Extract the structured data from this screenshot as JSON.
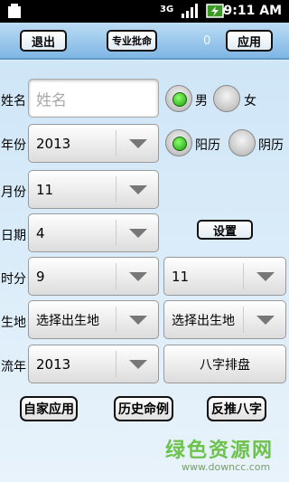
{
  "status": {
    "time": "9:11 AM",
    "network": "3G"
  },
  "toolbar": {
    "exit_label": "退出",
    "pro_label": "专业批命",
    "count": "0",
    "apply_label": "应用"
  },
  "form": {
    "name": {
      "label": "姓名",
      "placeholder": "姓名"
    },
    "gender": {
      "male": "男",
      "female": "女",
      "selected": "male"
    },
    "year": {
      "label": "年份",
      "value": "2013"
    },
    "calendar": {
      "solar": "阳历",
      "lunar": "阴历",
      "selected": "solar"
    },
    "month": {
      "label": "月份",
      "value": "11"
    },
    "day": {
      "label": "日期",
      "value": "4"
    },
    "settings_label": "设置",
    "time": {
      "label": "时分",
      "hour": "9",
      "minute": "11"
    },
    "birthplace": {
      "label": "生地",
      "province": "选择出生地",
      "city": "选择出生地"
    },
    "flow_year": {
      "label": "流年",
      "value": "2013"
    },
    "bazi_label": "八字排盘"
  },
  "bottom": {
    "own_apps": "自家应用",
    "history": "历史命例",
    "reverse": "反推八字"
  },
  "watermark": {
    "brand": "绿色资源网",
    "url": "www.downcc.com"
  }
}
